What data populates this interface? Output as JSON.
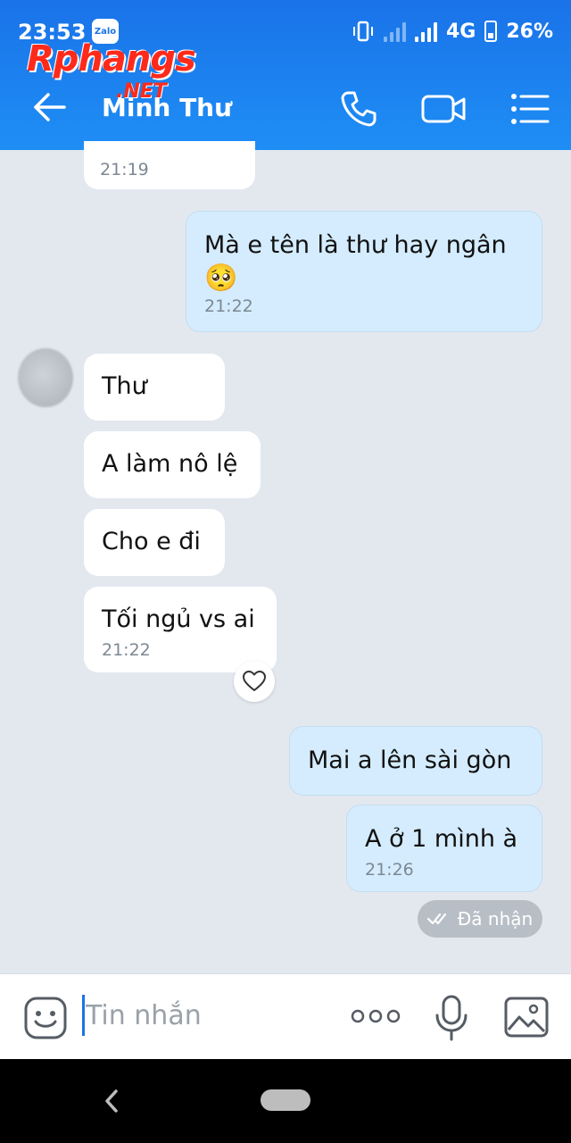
{
  "status_bar": {
    "time": "23:53",
    "app_badge": "Zalo",
    "network": "4G",
    "battery": "26%"
  },
  "watermark": {
    "brand": "Rphangs",
    "suffix": ".NET"
  },
  "header": {
    "contact_name": "Minh Thư",
    "icons": [
      "back-arrow-icon",
      "phone-icon",
      "video-call-icon",
      "menu-list-icon"
    ]
  },
  "messages": [
    {
      "direction": "in",
      "text": "",
      "time": "21:19"
    },
    {
      "direction": "out",
      "text": "Mà e tên là thư hay ngân",
      "emoji": "🥺",
      "time": "21:22"
    },
    {
      "direction": "in",
      "text": "Thư",
      "time": ""
    },
    {
      "direction": "in",
      "text": "A làm nô lệ",
      "time": ""
    },
    {
      "direction": "in",
      "text": "Cho e đi",
      "time": ""
    },
    {
      "direction": "in",
      "text": "Tối ngủ vs ai",
      "time": "21:22"
    },
    {
      "direction": "out",
      "text": "Mai a lên sài gòn",
      "time": ""
    },
    {
      "direction": "out",
      "text": "A ở 1 mình à",
      "time": "21:26"
    }
  ],
  "delivery_status": "Đã nhận",
  "input_bar": {
    "placeholder": "Tin nhắn",
    "icons": [
      "emoji-icon",
      "more-dots-icon",
      "microphone-icon",
      "image-icon"
    ]
  },
  "colors": {
    "header_blue": "#1a73e8",
    "bubble_out": "#d4ecfd",
    "bubble_in": "#ffffff",
    "chat_bg": "#e3e8ef"
  }
}
